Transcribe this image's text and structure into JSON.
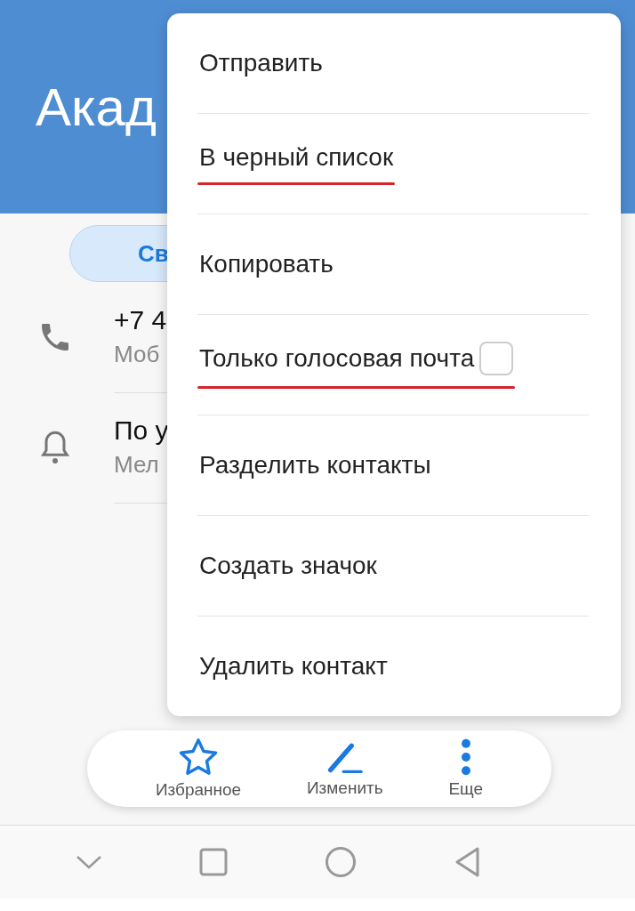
{
  "header": {
    "title": "Акад"
  },
  "action_button": {
    "label": "Св"
  },
  "details": [
    {
      "kind": "phone",
      "primary": "+7 4",
      "secondary": "Моб"
    },
    {
      "kind": "ringtone",
      "primary": "По у",
      "secondary": "Мел"
    }
  ],
  "menu": {
    "items": [
      {
        "label": "Отправить",
        "kind": "plain",
        "underlined": false
      },
      {
        "label": "В черный список",
        "kind": "plain",
        "underlined": true
      },
      {
        "label": "Копировать",
        "kind": "plain",
        "underlined": false
      },
      {
        "label": "Только голосовая почта",
        "kind": "checkbox",
        "checked": false,
        "underlined": true
      },
      {
        "label": "Разделить контакты",
        "kind": "plain",
        "underlined": false
      },
      {
        "label": "Создать значок",
        "kind": "plain",
        "underlined": false
      },
      {
        "label": "Удалить контакт",
        "kind": "plain",
        "underlined": false
      }
    ]
  },
  "bottom_actions": [
    {
      "kind": "favorite",
      "label": "Избранное"
    },
    {
      "kind": "edit",
      "label": "Изменить"
    },
    {
      "kind": "more",
      "label": "Еще"
    }
  ]
}
